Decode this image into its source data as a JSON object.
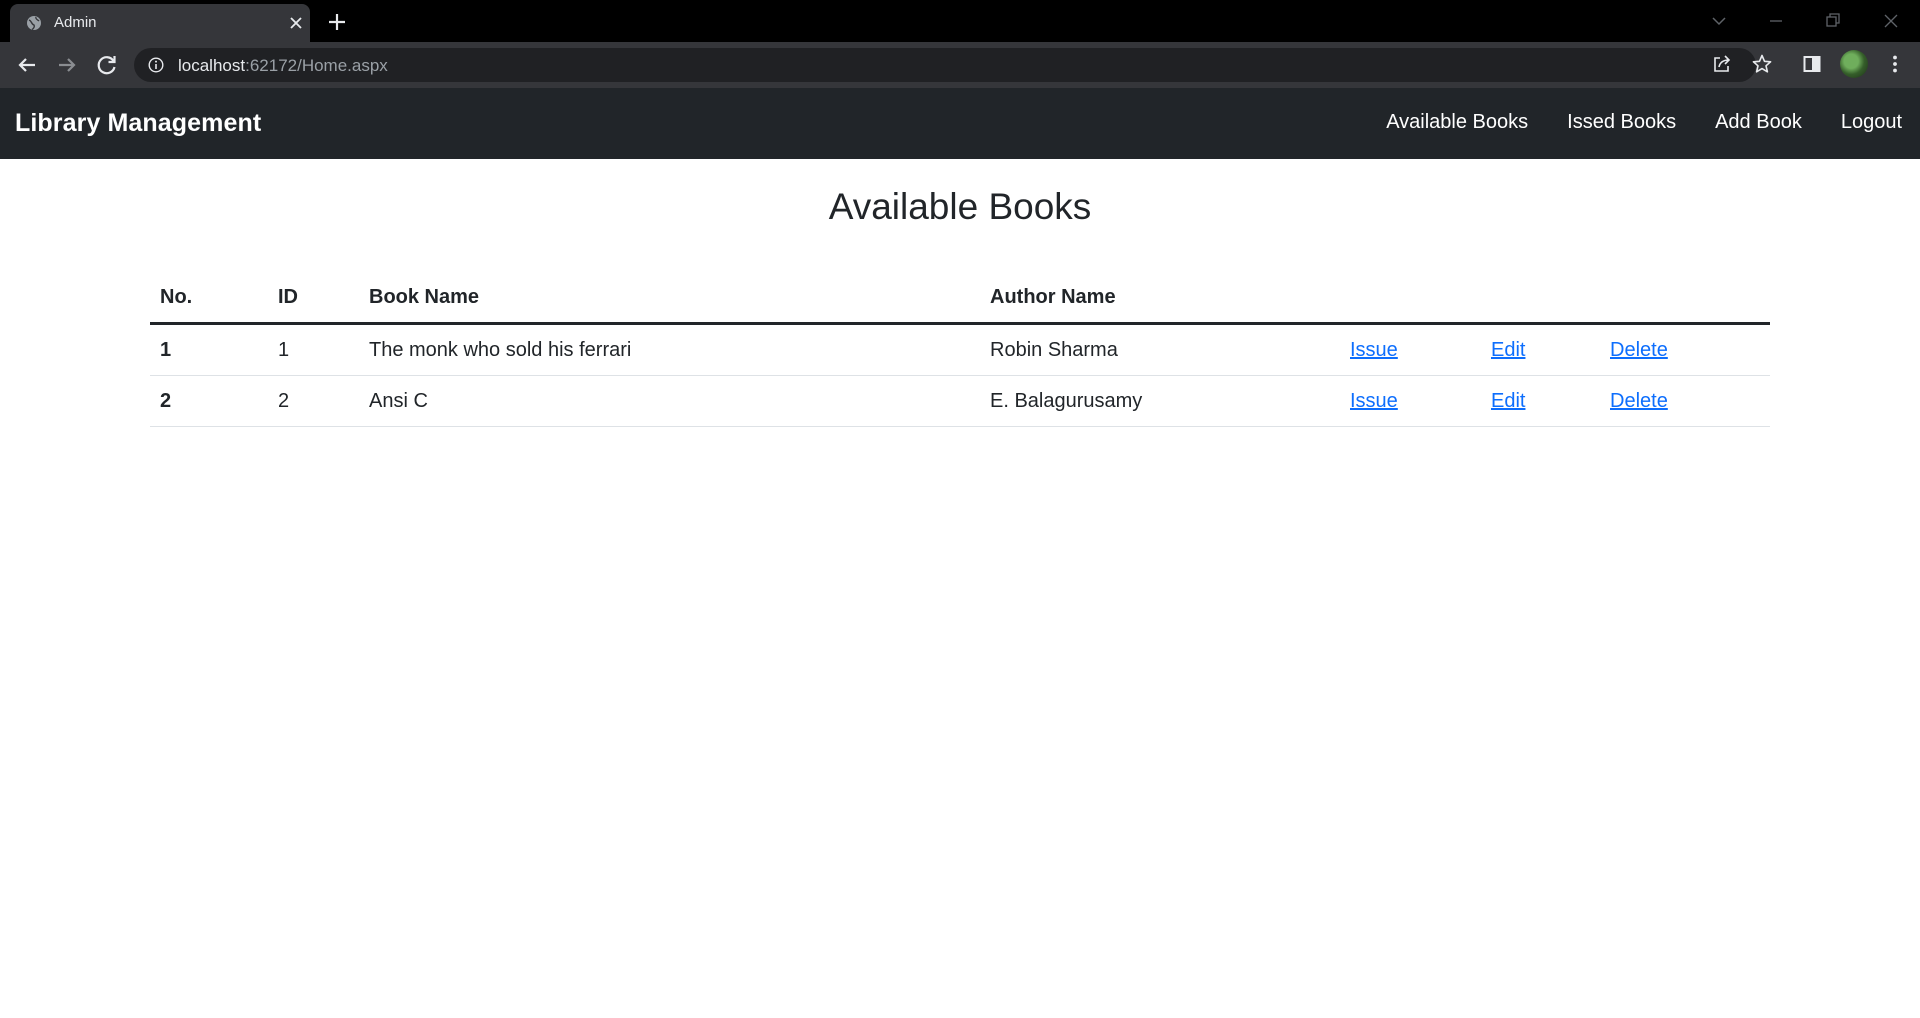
{
  "browser": {
    "tab_title": "Admin",
    "url_host": "localhost",
    "url_rest": ":62172/Home.aspx"
  },
  "navbar": {
    "brand": "Library Management",
    "links": [
      {
        "label": "Available Books"
      },
      {
        "label": "Issed Books"
      },
      {
        "label": "Add Book"
      },
      {
        "label": "Logout"
      }
    ]
  },
  "main": {
    "title": "Available Books",
    "table": {
      "headers": [
        "No.",
        "ID",
        "Book Name",
        "Author Name"
      ],
      "rows": [
        {
          "no": "1",
          "id": "1",
          "book": "The monk who sold his ferrari",
          "author": "Robin Sharma",
          "issue": "Issue",
          "edit": "Edit",
          "delete": "Delete"
        },
        {
          "no": "2",
          "id": "2",
          "book": "Ansi C",
          "author": "E. Balagurusamy",
          "issue": "Issue",
          "edit": "Edit",
          "delete": "Delete"
        }
      ]
    }
  },
  "colors": {
    "navbar_bg": "#212529",
    "link": "#0d6efd",
    "browser_frame": "#000000",
    "browser_toolbar": "#35363a"
  }
}
